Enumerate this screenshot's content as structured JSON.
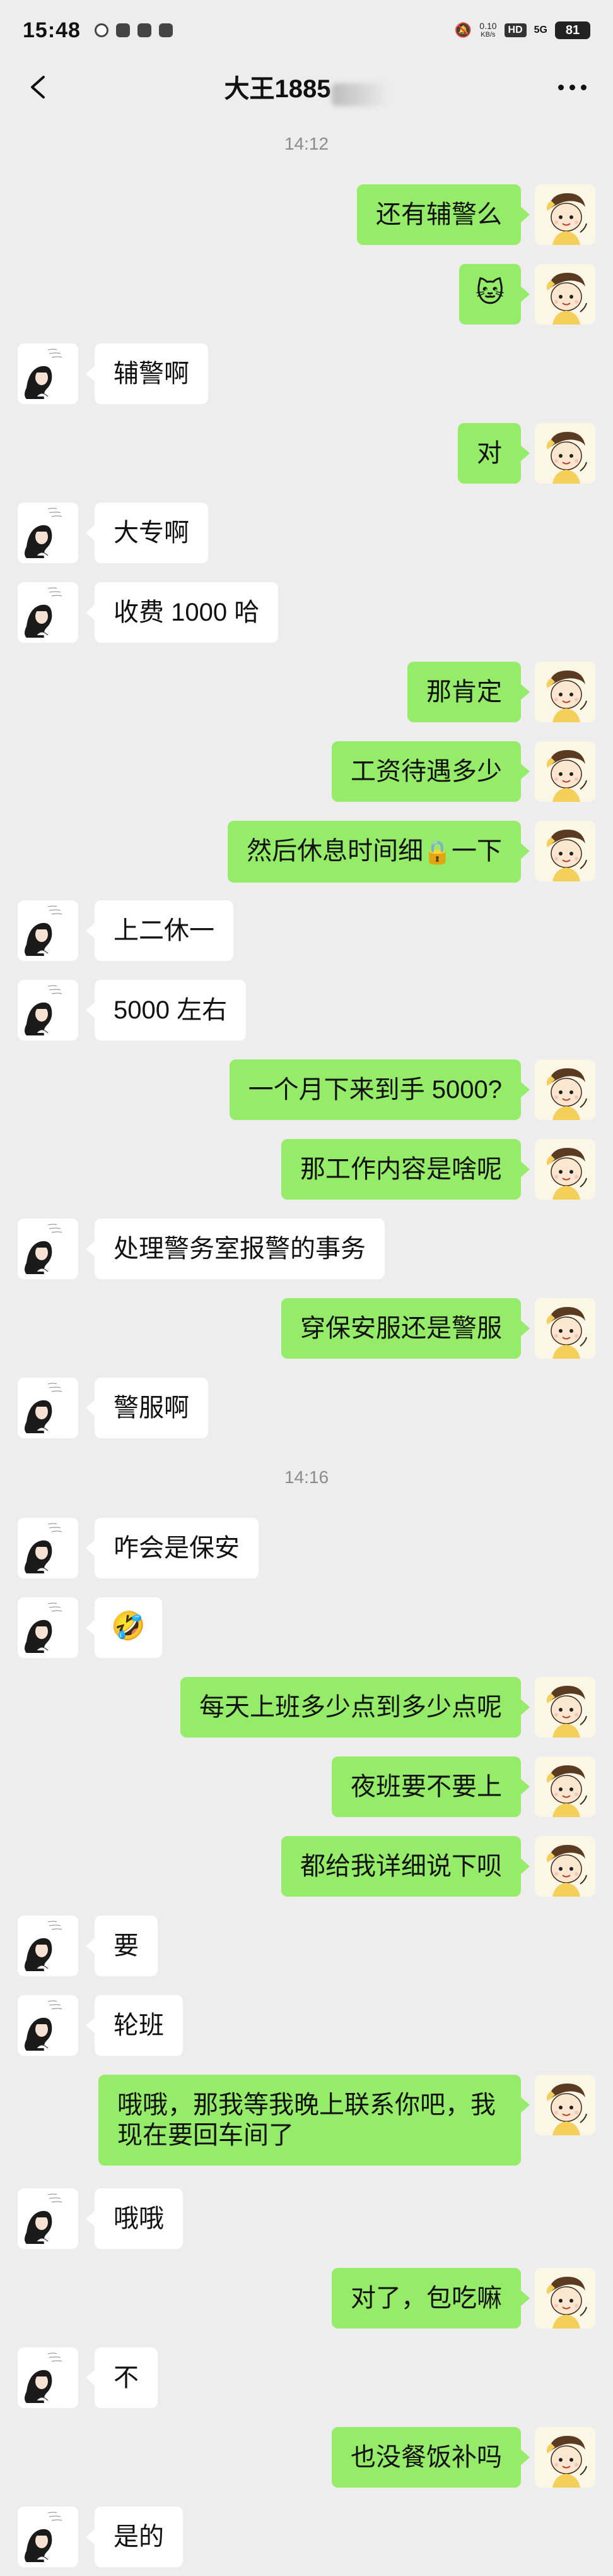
{
  "status_bar": {
    "time": "15:48",
    "net_speed": "0.10",
    "net_unit": "KB/s",
    "hd": "HD",
    "signal": "5G",
    "battery": "81"
  },
  "header": {
    "title": "大王1885"
  },
  "messages": [
    {
      "kind": "time",
      "text": "14:12"
    },
    {
      "kind": "me",
      "text": "还有辅警么"
    },
    {
      "kind": "me",
      "emoji": "🐱"
    },
    {
      "kind": "other",
      "text": "辅警啊"
    },
    {
      "kind": "me",
      "text": "对"
    },
    {
      "kind": "other",
      "text": "大专啊"
    },
    {
      "kind": "other",
      "text": "收费 1000 哈"
    },
    {
      "kind": "me",
      "text": "那肯定"
    },
    {
      "kind": "me",
      "text": "工资待遇多少"
    },
    {
      "kind": "me",
      "text": "然后休息时间细",
      "emoji_inline": "🔒",
      "text2": "一下"
    },
    {
      "kind": "other",
      "text": "上二休一"
    },
    {
      "kind": "other",
      "text": "5000 左右"
    },
    {
      "kind": "me",
      "text": "一个月下来到手 5000?"
    },
    {
      "kind": "me",
      "text": "那工作内容是啥呢"
    },
    {
      "kind": "other",
      "text": "处理警务室报警的事务"
    },
    {
      "kind": "me",
      "text": "穿保安服还是警服"
    },
    {
      "kind": "other",
      "text": "警服啊"
    },
    {
      "kind": "time",
      "text": "14:16"
    },
    {
      "kind": "other",
      "text": "咋会是保安"
    },
    {
      "kind": "other",
      "emoji": "🤣"
    },
    {
      "kind": "me",
      "text": "每天上班多少点到多少点呢"
    },
    {
      "kind": "me",
      "text": "夜班要不要上"
    },
    {
      "kind": "me",
      "text": "都给我详细说下呗"
    },
    {
      "kind": "other",
      "text": "要"
    },
    {
      "kind": "other",
      "text": "轮班"
    },
    {
      "kind": "me",
      "tall": true,
      "text": "哦哦，那我等我晚上联系你吧，我现在要回车间了"
    },
    {
      "kind": "other",
      "text": "哦哦"
    },
    {
      "kind": "me",
      "text": "对了，包吃嘛"
    },
    {
      "kind": "other",
      "text": "不"
    },
    {
      "kind": "me",
      "text": "也没餐饭补吗"
    },
    {
      "kind": "other",
      "text": "是的"
    }
  ],
  "colors": {
    "background": "#ededed",
    "me_bubble": "#95ec69",
    "other_bubble": "#ffffff"
  },
  "icons": {
    "back": "chevron-left-icon",
    "more": "more-dots-icon"
  }
}
